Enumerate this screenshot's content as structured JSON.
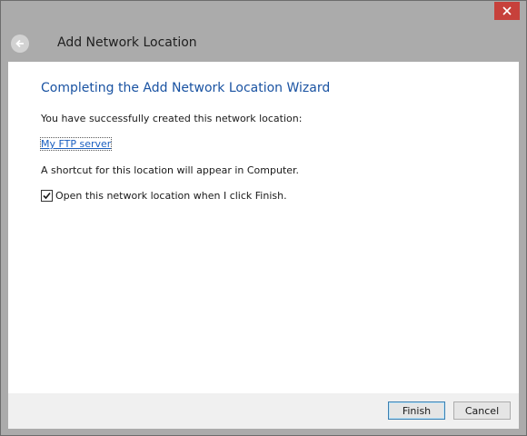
{
  "window": {
    "close_icon": "close-icon",
    "close_color": "#c7413b"
  },
  "header": {
    "back_icon": "back-arrow-icon",
    "title": "Add Network Location"
  },
  "main": {
    "heading": "Completing the Add Network Location Wizard",
    "success_text": "You have successfully created this network location:",
    "location_link": "My FTP server",
    "shortcut_text": "A shortcut for this location will appear in Computer.",
    "checkbox_label": "Open this network location when I click Finish.",
    "checkbox_checked": true
  },
  "footer": {
    "finish_label": "Finish",
    "cancel_label": "Cancel"
  },
  "colors": {
    "heading": "#1a53a2",
    "link": "#1a5fc0",
    "chrome": "#ababab"
  }
}
